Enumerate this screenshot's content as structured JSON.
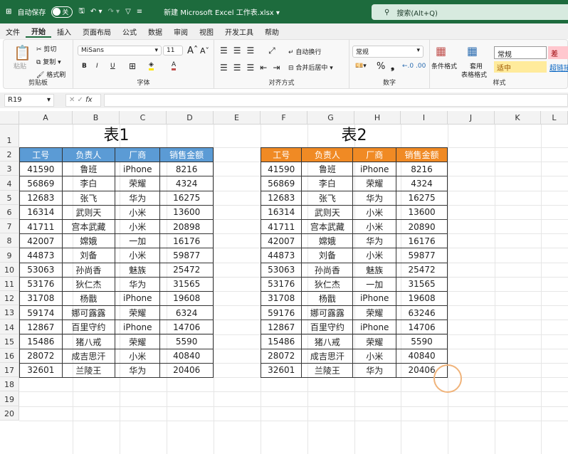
{
  "titlebar": {
    "autosave": "自动保存",
    "toggle": "关",
    "filename": "新建 Microsoft Excel 工作表.xlsx ▾",
    "search": "搜索(Alt+Q)"
  },
  "menu": [
    "文件",
    "开始",
    "插入",
    "页面布局",
    "公式",
    "数据",
    "审阅",
    "视图",
    "开发工具",
    "帮助"
  ],
  "ribbon": {
    "paste": "粘贴",
    "cut": "剪切",
    "copy": "复制",
    "format_painter": "格式刷",
    "clipboard": "剪贴板",
    "font_name": "MiSans",
    "font_size": "11",
    "font_group": "字体",
    "bold": "B",
    "italic": "I",
    "underline": "U",
    "wrap": "自动换行",
    "merge": "合并后居中",
    "align_group": "对齐方式",
    "number_format": "常规",
    "number_group": "数字",
    "percent": "%",
    "comma": "❟",
    "cond_format": "条件格式",
    "table_format_1": "套用",
    "table_format_2": "表格格式",
    "style_normal": "常规",
    "style_bad": "差",
    "style_neutral": "适中",
    "style_link": "超链接",
    "styles_group": "样式"
  },
  "formula": {
    "name_box": "R19",
    "fx": "fx",
    "value": ""
  },
  "columns": [
    "A",
    "B",
    "C",
    "D",
    "E",
    "F",
    "G",
    "H",
    "I",
    "J",
    "K",
    "L"
  ],
  "rows": [
    "1",
    "2",
    "3",
    "4",
    "5",
    "6",
    "7",
    "8",
    "9",
    "10",
    "11",
    "12",
    "13",
    "14",
    "15",
    "16",
    "17",
    "18",
    "19",
    "20"
  ],
  "table1": {
    "title": "表1",
    "header_color": "#5b9bd5",
    "headers": [
      "工号",
      "负责人",
      "厂商",
      "销售金额"
    ],
    "rows": [
      [
        "41590",
        "鲁班",
        "iPhone",
        "8216"
      ],
      [
        "56869",
        "李白",
        "荣耀",
        "4324"
      ],
      [
        "12683",
        "张飞",
        "华为",
        "16275"
      ],
      [
        "16314",
        "武则天",
        "小米",
        "13600"
      ],
      [
        "41711",
        "宫本武藏",
        "小米",
        "20898"
      ],
      [
        "42007",
        "嫦娥",
        "一加",
        "16176"
      ],
      [
        "44873",
        "刘备",
        "小米",
        "59877"
      ],
      [
        "53063",
        "孙尚香",
        "魅族",
        "25472"
      ],
      [
        "53176",
        "狄仁杰",
        "华为",
        "31565"
      ],
      [
        "31708",
        "杨戬",
        "iPhone",
        "19608"
      ],
      [
        "59174",
        "娜可露露",
        "荣耀",
        "6324"
      ],
      [
        "12867",
        "百里守约",
        "iPhone",
        "14706"
      ],
      [
        "15486",
        "猪八戒",
        "荣耀",
        "5590"
      ],
      [
        "28072",
        "成吉思汗",
        "小米",
        "40840"
      ],
      [
        "32601",
        "兰陵王",
        "华为",
        "20406"
      ]
    ]
  },
  "table2": {
    "title": "表2",
    "header_color": "#f08a24",
    "headers": [
      "工号",
      "负责人",
      "厂商",
      "销售金额"
    ],
    "rows": [
      [
        "41590",
        "鲁班",
        "iPhone",
        "8216"
      ],
      [
        "56869",
        "李白",
        "荣耀",
        "4324"
      ],
      [
        "12683",
        "张飞",
        "华为",
        "16275"
      ],
      [
        "16314",
        "武则天",
        "小米",
        "13600"
      ],
      [
        "41711",
        "宫本武藏",
        "小米",
        "20890"
      ],
      [
        "42007",
        "嫦娥",
        "华为",
        "16176"
      ],
      [
        "44873",
        "刘备",
        "小米",
        "59877"
      ],
      [
        "53063",
        "孙尚香",
        "魅族",
        "25472"
      ],
      [
        "53176",
        "狄仁杰",
        "一加",
        "31565"
      ],
      [
        "31708",
        "杨戬",
        "iPhone",
        "19608"
      ],
      [
        "59176",
        "娜可露露",
        "荣耀",
        "63246"
      ],
      [
        "12867",
        "百里守约",
        "iPhone",
        "14706"
      ],
      [
        "15486",
        "猪八戒",
        "荣耀",
        "5590"
      ],
      [
        "28072",
        "成吉思汗",
        "小米",
        "40840"
      ],
      [
        "32601",
        "兰陵王",
        "华为",
        "20406"
      ]
    ]
  }
}
